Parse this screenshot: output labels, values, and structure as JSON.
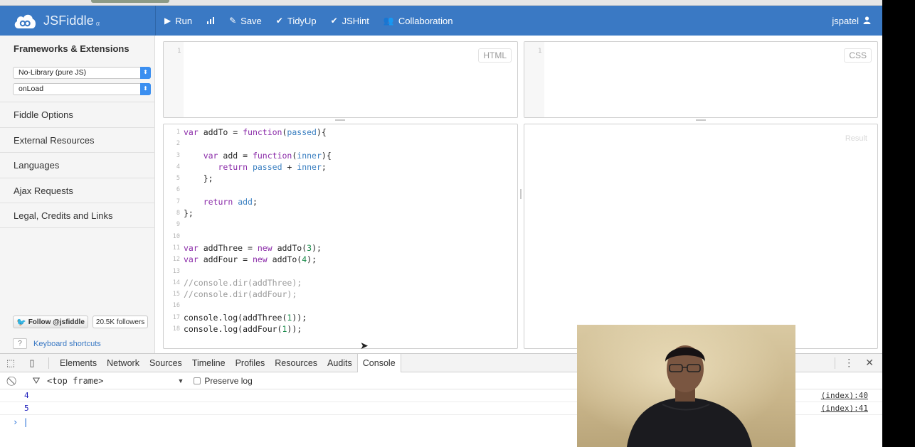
{
  "app": {
    "name": "JSFiddle",
    "badge": "α",
    "user": "jspatel"
  },
  "toolbar": {
    "run": "Run",
    "save": "Save",
    "tidyup": "TidyUp",
    "jshint": "JSHint",
    "collaboration": "Collaboration"
  },
  "sidebar": {
    "title": "Frameworks & Extensions",
    "library_select": "No-Library (pure JS)",
    "load_select": "onLoad",
    "items": [
      "Fiddle Options",
      "External Resources",
      "Languages",
      "Ajax Requests",
      "Legal, Credits and Links"
    ],
    "follow": "Follow @jsfiddle",
    "followers": "20.5K followers",
    "kbd_key": "?",
    "kbd_label": "Keyboard shortcuts"
  },
  "panels": {
    "html": "HTML",
    "css": "CSS",
    "result": "Result",
    "html_line": "1",
    "css_line": "1"
  },
  "code": [
    {
      "n": "1",
      "t": [
        [
          "kw",
          "var"
        ],
        [
          "p",
          " addTo = "
        ],
        [
          "kw",
          "function"
        ],
        [
          "p",
          "("
        ],
        [
          "var",
          "passed"
        ],
        [
          "p",
          "){"
        ]
      ]
    },
    {
      "n": "2",
      "t": []
    },
    {
      "n": "3",
      "t": [
        [
          "p",
          "    "
        ],
        [
          "kw",
          "var"
        ],
        [
          "p",
          " add = "
        ],
        [
          "kw",
          "function"
        ],
        [
          "p",
          "("
        ],
        [
          "var",
          "inner"
        ],
        [
          "p",
          "){"
        ]
      ]
    },
    {
      "n": "4",
      "t": [
        [
          "p",
          "       "
        ],
        [
          "kw",
          "return"
        ],
        [
          "p",
          " "
        ],
        [
          "var",
          "passed"
        ],
        [
          "p",
          " + "
        ],
        [
          "var",
          "inner"
        ],
        [
          "p",
          ";"
        ]
      ]
    },
    {
      "n": "5",
      "t": [
        [
          "p",
          "    };"
        ]
      ]
    },
    {
      "n": "6",
      "t": []
    },
    {
      "n": "7",
      "t": [
        [
          "p",
          "    "
        ],
        [
          "kw",
          "return"
        ],
        [
          "p",
          " "
        ],
        [
          "var",
          "add"
        ],
        [
          "p",
          ";"
        ]
      ]
    },
    {
      "n": "8",
      "t": [
        [
          "p",
          "};"
        ]
      ]
    },
    {
      "n": "9",
      "t": []
    },
    {
      "n": "10",
      "t": []
    },
    {
      "n": "11",
      "t": [
        [
          "kw",
          "var"
        ],
        [
          "p",
          " addThree = "
        ],
        [
          "kw",
          "new"
        ],
        [
          "p",
          " addTo("
        ],
        [
          "num",
          "3"
        ],
        [
          "p",
          ");"
        ]
      ]
    },
    {
      "n": "12",
      "t": [
        [
          "kw",
          "var"
        ],
        [
          "p",
          " addFour = "
        ],
        [
          "kw",
          "new"
        ],
        [
          "p",
          " addTo("
        ],
        [
          "num",
          "4"
        ],
        [
          "p",
          ");"
        ]
      ]
    },
    {
      "n": "13",
      "t": []
    },
    {
      "n": "14",
      "t": [
        [
          "cm",
          "//console.dir(addThree);"
        ]
      ]
    },
    {
      "n": "15",
      "t": [
        [
          "cm",
          "//console.dir(addFour);"
        ]
      ]
    },
    {
      "n": "16",
      "t": []
    },
    {
      "n": "17",
      "t": [
        [
          "p",
          "console.log(addThree("
        ],
        [
          "num",
          "1"
        ],
        [
          "p",
          "));"
        ]
      ]
    },
    {
      "n": "18",
      "t": [
        [
          "p",
          "console.log(addFour("
        ],
        [
          "num",
          "1"
        ],
        [
          "p",
          "));"
        ]
      ]
    }
  ],
  "devtools": {
    "tabs": [
      "Elements",
      "Network",
      "Sources",
      "Timeline",
      "Profiles",
      "Resources",
      "Audits",
      "Console"
    ],
    "active_tab": "Console",
    "frame": "<top frame>",
    "preserve_log": "Preserve log",
    "logs": [
      {
        "value": "4",
        "source": "(index):40"
      },
      {
        "value": "5",
        "source": "(index):41"
      }
    ],
    "prompt": "›"
  },
  "colors": {
    "header": "#3a79c4",
    "keyword": "#8a2aa8",
    "variable": "#3a7fc1",
    "number": "#1a8a4a",
    "comment": "#999999"
  },
  "icons": {
    "run": "play-icon",
    "stats": "bar-chart-icon",
    "save": "pencil-icon",
    "tidyup": "check-icon",
    "jshint": "check-icon",
    "collaboration": "users-icon",
    "user": "user-icon"
  }
}
